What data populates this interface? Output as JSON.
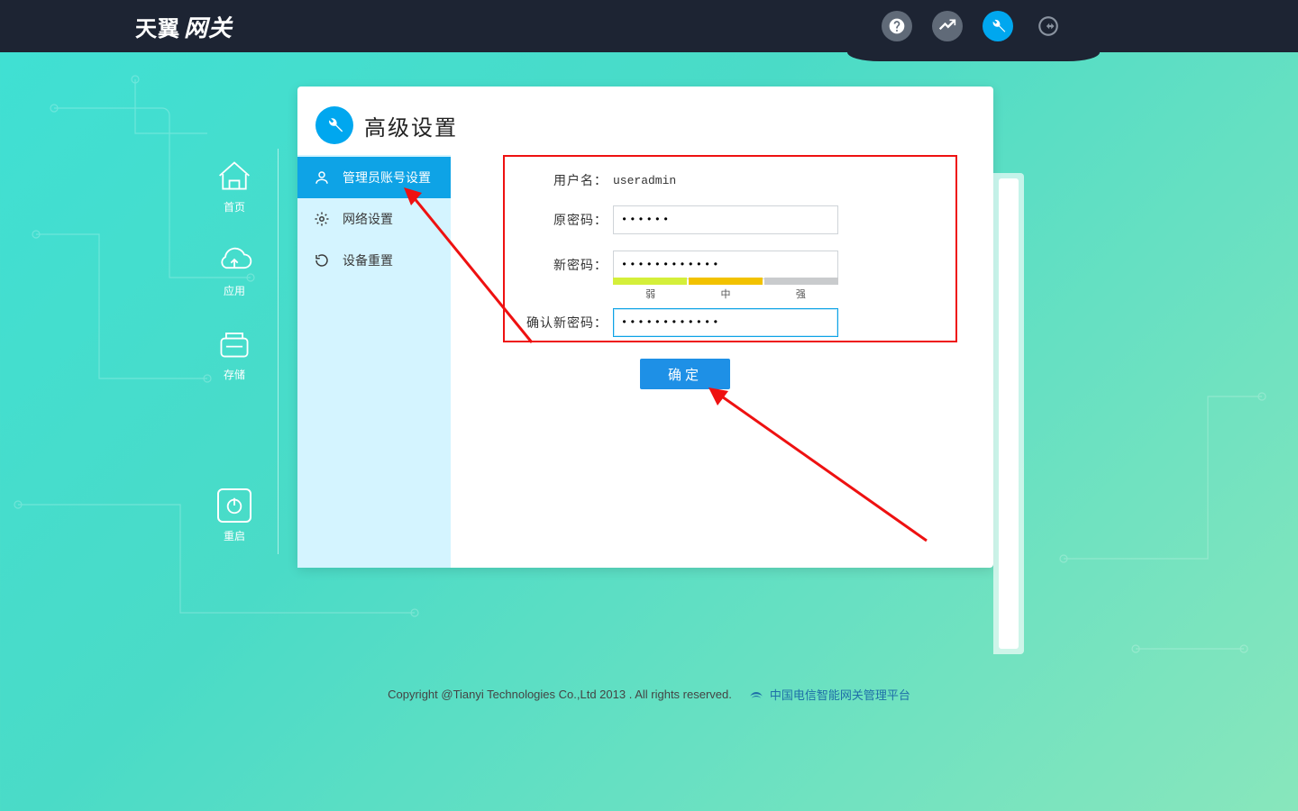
{
  "logo": {
    "part1": "天翼",
    "part2": "网关"
  },
  "header_icons": {
    "help": "help-icon",
    "stats": "stats-icon",
    "settings": "wrench-icon",
    "logout": "logout-icon"
  },
  "leftnav": [
    {
      "id": "home",
      "label": "首页"
    },
    {
      "id": "apps",
      "label": "应用"
    },
    {
      "id": "storage",
      "label": "存储"
    },
    {
      "id": "restart",
      "label": "重启"
    }
  ],
  "page_title": "高级设置",
  "sub_sidebar": [
    {
      "id": "admin-account",
      "label": "管理员账号设置",
      "active": true
    },
    {
      "id": "network",
      "label": "网络设置",
      "active": false
    },
    {
      "id": "reset",
      "label": "设备重置",
      "active": false
    }
  ],
  "form": {
    "username_label": "用户名：",
    "username_value": "useradmin",
    "oldpw_label": "原密码：",
    "oldpw_value": "••••••",
    "newpw_label": "新密码：",
    "newpw_value": "••••••••••••",
    "confirm_label": "确认新密码：",
    "confirm_value": "••••••••••••",
    "strength_labels": {
      "weak": "弱",
      "medium": "中",
      "strong": "强"
    },
    "submit_label": "确定"
  },
  "footer": {
    "copyright": "Copyright @Tianyi Technologies Co.,Ltd 2013 . All rights reserved.",
    "platform": "中国电信智能网关管理平台"
  },
  "colors": {
    "accent": "#0ea3e6",
    "header_bg": "#1d2433",
    "highlight_red": "#e11"
  }
}
